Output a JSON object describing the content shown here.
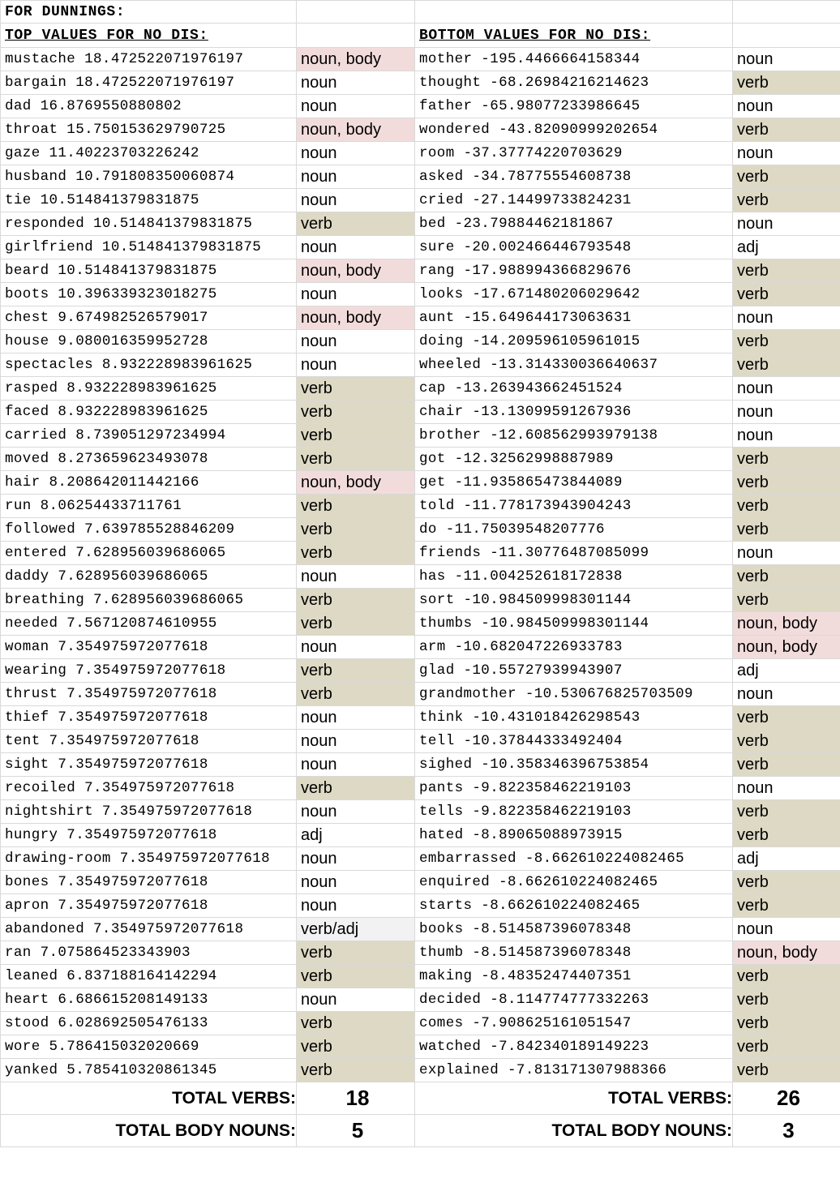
{
  "sheet_title": "FOR DUNNINGS:",
  "left_header": "TOP VALUES FOR NO DIS:",
  "right_header": "BOTTOM VALUES FOR NO DIS:",
  "colors": {
    "verb": "#ddd9c4",
    "body": "#f2dcdb",
    "mixed": "#f2f2f2"
  },
  "rows": [
    {
      "lw": "mustache 18.472522071976197",
      "lt": "noun, body",
      "rw": "mother -195.4466664158344",
      "rt": "noun"
    },
    {
      "lw": "bargain 18.472522071976197",
      "lt": "noun",
      "rw": "thought -68.26984216214623",
      "rt": "verb"
    },
    {
      "lw": "dad 16.8769550880802",
      "lt": "noun",
      "rw": "father -65.98077233986645",
      "rt": "noun"
    },
    {
      "lw": "throat 15.750153629790725",
      "lt": "noun, body",
      "rw": "wondered -43.82090999202654",
      "rt": "verb"
    },
    {
      "lw": "gaze 11.40223703226242",
      "lt": "noun",
      "rw": "room -37.37774220703629",
      "rt": "noun"
    },
    {
      "lw": "husband 10.791808350060874",
      "lt": "noun",
      "rw": "asked -34.78775554608738",
      "rt": "verb"
    },
    {
      "lw": "tie 10.514841379831875",
      "lt": "noun",
      "rw": "cried -27.14499733824231",
      "rt": "verb"
    },
    {
      "lw": "responded 10.514841379831875",
      "lt": "verb",
      "rw": "bed -23.79884462181867",
      "rt": "noun"
    },
    {
      "lw": "girlfriend 10.514841379831875",
      "lt": "noun",
      "rw": "sure -20.002466446793548",
      "rt": "adj"
    },
    {
      "lw": "beard 10.514841379831875",
      "lt": "noun, body",
      "rw": "rang -17.988994366829676",
      "rt": "verb"
    },
    {
      "lw": "boots 10.396339323018275",
      "lt": "noun",
      "rw": "looks -17.671480206029642",
      "rt": "verb"
    },
    {
      "lw": "chest 9.674982526579017",
      "lt": "noun, body",
      "rw": "aunt -15.649644173063631",
      "rt": "noun"
    },
    {
      "lw": "house 9.080016359952728",
      "lt": "noun",
      "rw": "doing -14.209596105961015",
      "rt": "verb"
    },
    {
      "lw": "spectacles 8.932228983961625",
      "lt": "noun",
      "rw": "wheeled -13.314330036640637",
      "rt": "verb"
    },
    {
      "lw": "rasped 8.932228983961625",
      "lt": "verb",
      "rw": "cap -13.263943662451524",
      "rt": "noun"
    },
    {
      "lw": "faced 8.932228983961625",
      "lt": "verb",
      "rw": "chair -13.13099591267936",
      "rt": "noun"
    },
    {
      "lw": "carried 8.739051297234994",
      "lt": "verb",
      "rw": "brother -12.608562993979138",
      "rt": "noun"
    },
    {
      "lw": "moved 8.273659623493078",
      "lt": "verb",
      "rw": "got -12.32562998887989",
      "rt": "verb"
    },
    {
      "lw": "hair 8.208642011442166",
      "lt": "noun, body",
      "rw": "get -11.935865473844089",
      "rt": "verb"
    },
    {
      "lw": "run 8.06254433711761",
      "lt": "verb",
      "rw": "told -11.778173943904243",
      "rt": "verb"
    },
    {
      "lw": "followed 7.639785528846209",
      "lt": "verb",
      "rw": "do -11.75039548207776",
      "rt": "verb"
    },
    {
      "lw": "entered 7.628956039686065",
      "lt": "verb",
      "rw": "friends -11.30776487085099",
      "rt": "noun"
    },
    {
      "lw": "daddy 7.628956039686065",
      "lt": "noun",
      "rw": "has -11.004252618172838",
      "rt": "verb"
    },
    {
      "lw": "breathing 7.628956039686065",
      "lt": "verb",
      "rw": "sort -10.984509998301144",
      "rt": "verb"
    },
    {
      "lw": "needed 7.567120874610955",
      "lt": "verb",
      "rw": "thumbs -10.984509998301144",
      "rt": "noun, body"
    },
    {
      "lw": "woman 7.354975972077618",
      "lt": "noun",
      "rw": "arm -10.682047226933783",
      "rt": "noun, body"
    },
    {
      "lw": "wearing 7.354975972077618",
      "lt": "verb",
      "rw": "glad -10.55727939943907",
      "rt": "adj"
    },
    {
      "lw": "thrust 7.354975972077618",
      "lt": "verb",
      "rw": "grandmother -10.530676825703509",
      "rt": "noun"
    },
    {
      "lw": "thief 7.354975972077618",
      "lt": "noun",
      "rw": "think -10.431018426298543",
      "rt": "verb"
    },
    {
      "lw": "tent 7.354975972077618",
      "lt": "noun",
      "rw": "tell -10.37844333492404",
      "rt": "verb"
    },
    {
      "lw": "sight 7.354975972077618",
      "lt": "noun",
      "rw": "sighed -10.358346396753854",
      "rt": "verb"
    },
    {
      "lw": "recoiled 7.354975972077618",
      "lt": "verb",
      "rw": "pants -9.822358462219103",
      "rt": "noun"
    },
    {
      "lw": "nightshirt 7.354975972077618",
      "lt": "noun",
      "rw": "tells -9.822358462219103",
      "rt": "verb"
    },
    {
      "lw": "hungry 7.354975972077618",
      "lt": "adj",
      "rw": "hated -8.89065088973915",
      "rt": "verb"
    },
    {
      "lw": "drawing-room 7.354975972077618",
      "lt": "noun",
      "rw": "embarrassed -8.662610224082465",
      "rt": "adj"
    },
    {
      "lw": "bones 7.354975972077618",
      "lt": "noun",
      "rw": "enquired -8.662610224082465",
      "rt": "verb"
    },
    {
      "lw": "apron 7.354975972077618",
      "lt": "noun",
      "rw": "starts -8.662610224082465",
      "rt": "verb"
    },
    {
      "lw": "abandoned 7.354975972077618",
      "lt": "verb/adj",
      "rw": "books -8.514587396078348",
      "rt": "noun"
    },
    {
      "lw": "ran 7.075864523343903",
      "lt": "verb",
      "rw": "thumb -8.514587396078348",
      "rt": "noun, body"
    },
    {
      "lw": "leaned 6.837188164142294",
      "lt": "verb",
      "rw": "making -8.48352474407351",
      "rt": "verb"
    },
    {
      "lw": "heart 6.686615208149133",
      "lt": "noun",
      "rw": "decided -8.114774777332263",
      "rt": "verb"
    },
    {
      "lw": "stood 6.028692505476133",
      "lt": "verb",
      "rw": "comes -7.908625161051547",
      "rt": "verb"
    },
    {
      "lw": "wore 5.786415032020669",
      "lt": "verb",
      "rw": "watched -7.842340189149223",
      "rt": "verb"
    },
    {
      "lw": "yanked 5.785410320861345",
      "lt": "verb",
      "rw": "explained -7.813171307988366",
      "rt": "verb"
    }
  ],
  "totals": {
    "verbs_label": "TOTAL VERBS:",
    "body_label": "TOTAL BODY NOUNS:",
    "left_verbs": "18",
    "left_body": "5",
    "right_verbs": "26",
    "right_body": "3"
  }
}
